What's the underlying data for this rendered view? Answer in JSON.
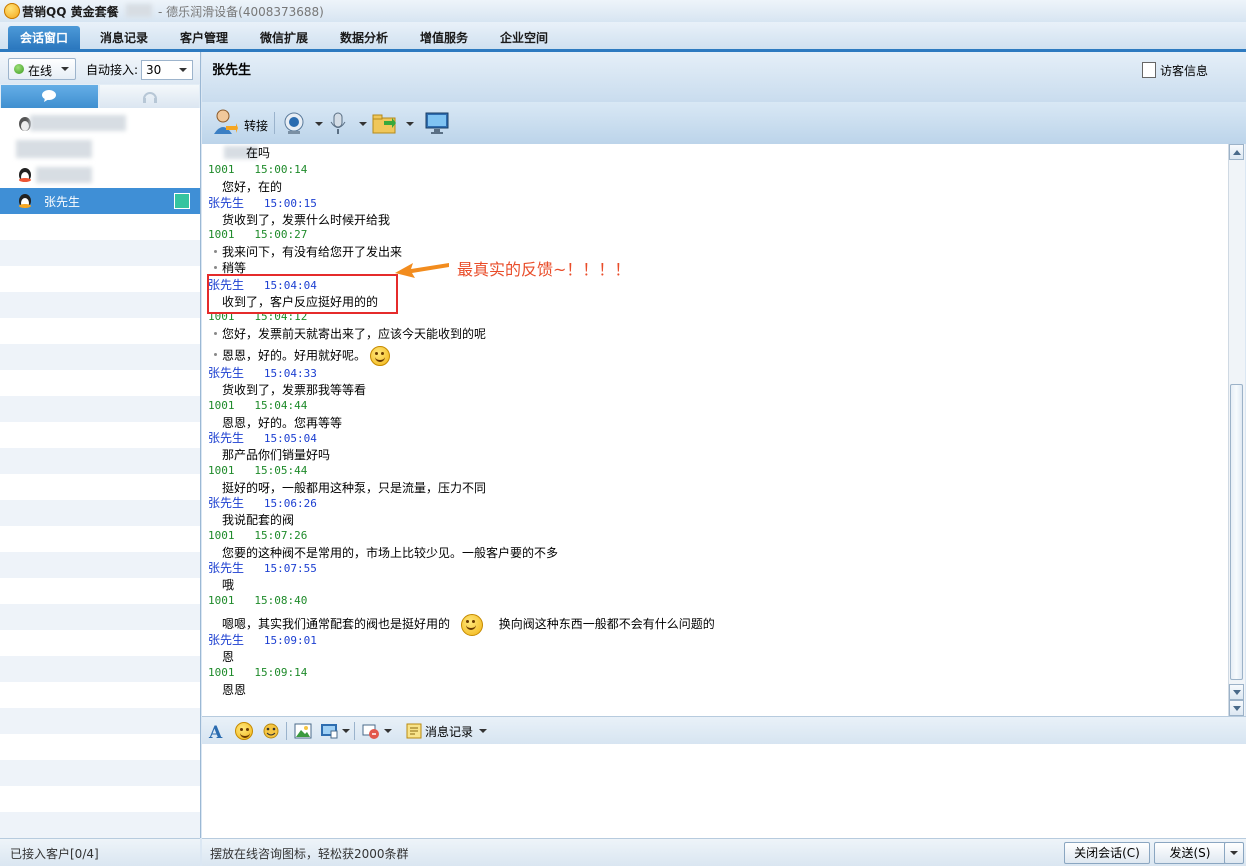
{
  "window": {
    "title": "营销QQ 黄金套餐",
    "subtitle": "- 德乐润滑设备(4008373688)"
  },
  "tabs": [
    {
      "label": "会话窗口",
      "active": true
    },
    {
      "label": "消息记录",
      "active": false
    },
    {
      "label": "客户管理",
      "active": false
    },
    {
      "label": "微信扩展",
      "active": false
    },
    {
      "label": "数据分析",
      "active": false
    },
    {
      "label": "增值服务",
      "active": false
    },
    {
      "label": "企业空间",
      "active": false
    }
  ],
  "left_panel": {
    "status": "在线",
    "auto_accept_label": "自动接入:",
    "auto_accept_value": "30",
    "selected_contact": "张先生",
    "footer": "已接入客户[0/4]"
  },
  "chat": {
    "customer_name": "张先生",
    "visitor_info": "访客信息",
    "transfer_label": "转接",
    "partial_top": "在吗",
    "messages": [
      {
        "sender": "1001",
        "time": "15:00:14",
        "type": "agent",
        "lines": [
          "您好，在的"
        ]
      },
      {
        "sender": "张先生",
        "time": "15:00:15",
        "type": "cust",
        "lines": [
          "货收到了，发票什么时候开给我"
        ]
      },
      {
        "sender": "1001",
        "time": "15:00:27",
        "type": "agent",
        "lines": [
          "我来问下，有没有给您开了发出来",
          "稍等"
        ],
        "bullets": true
      },
      {
        "sender": "张先生",
        "time": "15:04:04",
        "type": "cust",
        "lines": [
          "收到了，客户反应挺好用的的"
        ]
      },
      {
        "sender": "1001",
        "time": "15:04:12",
        "type": "agent",
        "lines": [
          "您好，发票前天就寄出来了，应该今天能收到的呢",
          "恩恩，好的。好用就好呢。"
        ],
        "bullets": true
      },
      {
        "sender": "张先生",
        "time": "15:04:33",
        "type": "cust",
        "lines": [
          "货收到了，发票那我等等看"
        ]
      },
      {
        "sender": "1001",
        "time": "15:04:44",
        "type": "agent",
        "lines": [
          "恩恩，好的。您再等等"
        ]
      },
      {
        "sender": "张先生",
        "time": "15:05:04",
        "type": "cust",
        "lines": [
          "那产品你们销量好吗"
        ]
      },
      {
        "sender": "1001",
        "time": "15:05:44",
        "type": "agent",
        "lines": [
          "挺好的呀，一般都用这种泵，只是流量，压力不同"
        ]
      },
      {
        "sender": "张先生",
        "time": "15:06:26",
        "type": "cust",
        "lines": [
          "我说配套的阀"
        ]
      },
      {
        "sender": "1001",
        "time": "15:07:26",
        "type": "agent",
        "lines": [
          "您要的这种阀不是常用的，市场上比较少见。一般客户要的不多"
        ]
      },
      {
        "sender": "张先生",
        "time": "15:07:55",
        "type": "cust",
        "lines": [
          "哦"
        ]
      },
      {
        "sender": "1001",
        "time": "15:08:40",
        "type": "agent",
        "lines": [
          "嗯嗯，其实我们通常配套的阀也是挺好用的"
        ],
        "tail": "换向阀这种东西一般都不会有什么问题的"
      },
      {
        "sender": "张先生",
        "time": "15:09:01",
        "type": "cust",
        "lines": [
          "恩"
        ]
      },
      {
        "sender": "1001",
        "time": "15:09:14",
        "type": "agent",
        "lines": [
          "恩恩"
        ]
      }
    ],
    "annotation": "最真实的反馈~！！！！",
    "history_label": "消息记录"
  },
  "bottom": {
    "promo": "摆放在线咨询图标，轻松获2000条群",
    "close_button": "关闭会话(C)",
    "send_button": "发送(S)"
  }
}
